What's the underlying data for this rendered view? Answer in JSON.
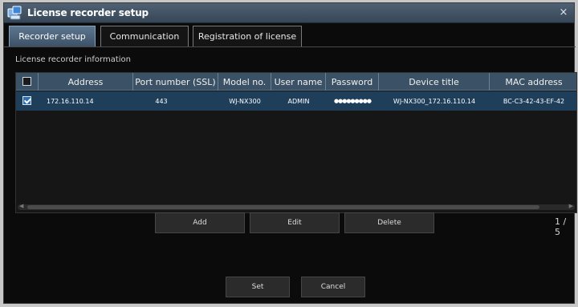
{
  "window": {
    "title": "License recorder setup",
    "close_symbol": "×"
  },
  "tabs": [
    {
      "label": "Recorder setup",
      "active": true
    },
    {
      "label": "Communication",
      "active": false
    },
    {
      "label": "Registration of license",
      "active": false
    }
  ],
  "section": {
    "label": "License recorder information"
  },
  "table": {
    "columns": [
      "Address",
      "Port number (SSL)",
      "Model no.",
      "User name",
      "Password",
      "Device title",
      "MAC address"
    ],
    "rows": [
      {
        "checked": true,
        "address": "172.16.110.14",
        "port": "443",
        "model": "WJ-NX300",
        "user": "ADMIN",
        "password": "●●●●●●●●●",
        "device_title": "WJ-NX300_172.16.110.14",
        "mac": "BC-C3-42-43-EF-42"
      }
    ]
  },
  "buttons": {
    "add": "Add",
    "edit": "Edit",
    "delete": "Delete",
    "set": "Set",
    "cancel": "Cancel"
  },
  "pagination": {
    "text": "1 / 5"
  },
  "colors": {
    "accent": "#3b5266",
    "selected_row": "#1e3e5a",
    "background": "#0b0b0b"
  }
}
